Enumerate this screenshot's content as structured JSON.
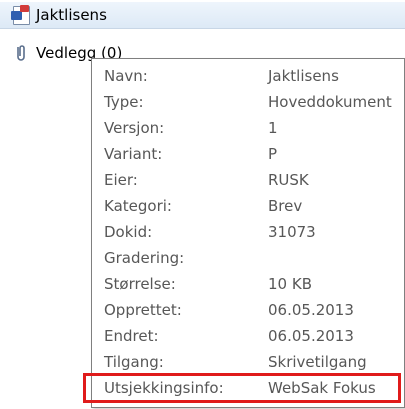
{
  "tree": {
    "items": [
      {
        "label": "Jaktlisens",
        "icon": "word-document-icon"
      },
      {
        "label": "Vedlegg (0)",
        "icon": "paperclip-icon"
      }
    ]
  },
  "tooltip": {
    "rows": [
      {
        "label": "Navn:",
        "value": "Jaktlisens"
      },
      {
        "label": "Type:",
        "value": "Hoveddokument"
      },
      {
        "label": "Versjon:",
        "value": "1"
      },
      {
        "label": "Variant:",
        "value": "P"
      },
      {
        "label": "Eier:",
        "value": "RUSK"
      },
      {
        "label": "Kategori:",
        "value": "Brev"
      },
      {
        "label": "Dokid:",
        "value": "31073"
      },
      {
        "label": "Gradering:",
        "value": ""
      },
      {
        "label": "Størrelse:",
        "value": "10 KB"
      },
      {
        "label": "Opprettet:",
        "value": "06.05.2013"
      },
      {
        "label": "Endret:",
        "value": "06.05.2013"
      },
      {
        "label": "Tilgang:",
        "value": "Skrivetilgang"
      },
      {
        "label": "Utsjekkingsinfo:",
        "value": "WebSak Fokus"
      }
    ]
  },
  "colors": {
    "highlight": "#e01b1b",
    "selection": "#dde9f6",
    "tooltip_text": "#575757"
  }
}
